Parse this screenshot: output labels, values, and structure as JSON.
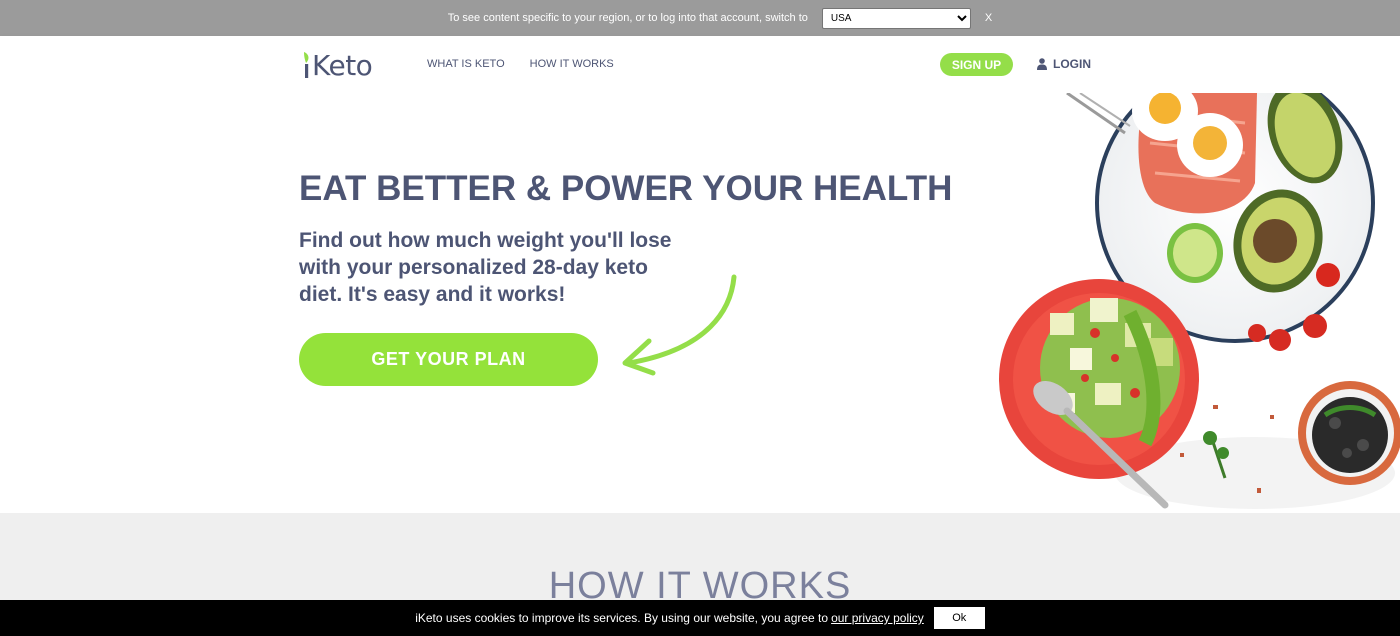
{
  "region_bar": {
    "text": "To see content specific to your region, or to log into that account, switch to",
    "selected_region": "USA",
    "close_label": "X"
  },
  "header": {
    "logo_text": "Keto",
    "nav": [
      "WHAT IS KETO",
      "HOW IT WORKS"
    ],
    "signup_label": "SIGN UP",
    "login_label": "LOGIN"
  },
  "hero": {
    "title": "EAT BETTER & POWER YOUR HEALTH",
    "subtitle": "Find out how much weight you'll lose with your personalized 28-day keto diet. It's easy and it works!",
    "cta_label": "GET YOUR PLAN"
  },
  "how_it_works": {
    "title": "HOW IT WORKS"
  },
  "cookie_bar": {
    "text": "iKeto uses cookies to improve its services. By using our website, you agree to",
    "link_text": "our privacy policy",
    "ok_label": "Ok"
  },
  "colors": {
    "brand_green": "#94de49",
    "text_navy": "#4d5574",
    "region_bar_bg": "#9b9b9b",
    "section_bg": "#efefef"
  },
  "icons": [
    "leaf-icon",
    "user-icon",
    "arrow-icon"
  ]
}
